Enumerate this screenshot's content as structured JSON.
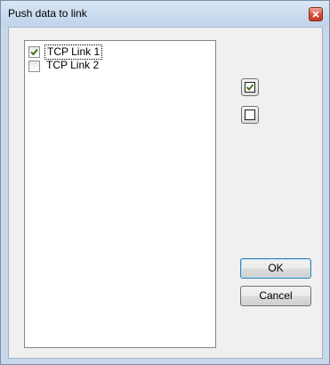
{
  "window": {
    "title": "Push data to link"
  },
  "links": [
    {
      "label": "TCP Link 1",
      "checked": true,
      "focused": true
    },
    {
      "label": "TCP Link 2",
      "checked": false,
      "focused": false
    }
  ],
  "buttons": {
    "ok_label": "OK",
    "cancel_label": "Cancel"
  },
  "icons": {
    "close": "close-icon",
    "select_all": "checkbox-checked-icon",
    "select_none": "checkbox-empty-icon"
  },
  "colors": {
    "title_bar": "#c9dbee",
    "close_button": "#d9543c",
    "check_mark": "#3a6a18",
    "default_button_border": "#3c7fb1"
  }
}
